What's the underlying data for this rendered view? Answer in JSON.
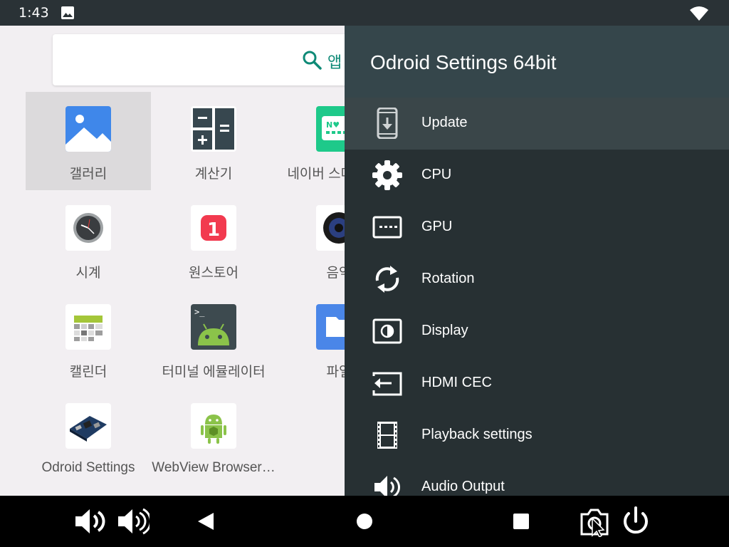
{
  "status_bar": {
    "time": "1:43"
  },
  "search": {
    "hint": "앱"
  },
  "apps": [
    {
      "label": "갤러리"
    },
    {
      "label": "계산기"
    },
    {
      "label": "네이버 스마트보드"
    },
    {
      "label": "시계"
    },
    {
      "label": "원스토어"
    },
    {
      "label": "음악"
    },
    {
      "label": "캘린더"
    },
    {
      "label": "터미널 에뮬레이터"
    },
    {
      "label": "파일"
    },
    {
      "label": "Odroid Settings"
    },
    {
      "label": "WebView Browser…"
    }
  ],
  "drawer": {
    "title": "Odroid Settings 64bit",
    "items": [
      {
        "label": "Update",
        "icon": "update-icon"
      },
      {
        "label": "CPU",
        "icon": "gear-icon"
      },
      {
        "label": "GPU",
        "icon": "gpu-icon"
      },
      {
        "label": "Rotation",
        "icon": "rotation-icon"
      },
      {
        "label": "Display",
        "icon": "display-icon"
      },
      {
        "label": "HDMI CEC",
        "icon": "hdmi-cec-icon"
      },
      {
        "label": "Playback settings",
        "icon": "film-icon"
      },
      {
        "label": "Audio Output",
        "icon": "speaker-icon"
      }
    ]
  },
  "colors": {
    "drawer_bg": "#273033",
    "drawer_header": "#35464b",
    "accent": "#0f8a77"
  }
}
